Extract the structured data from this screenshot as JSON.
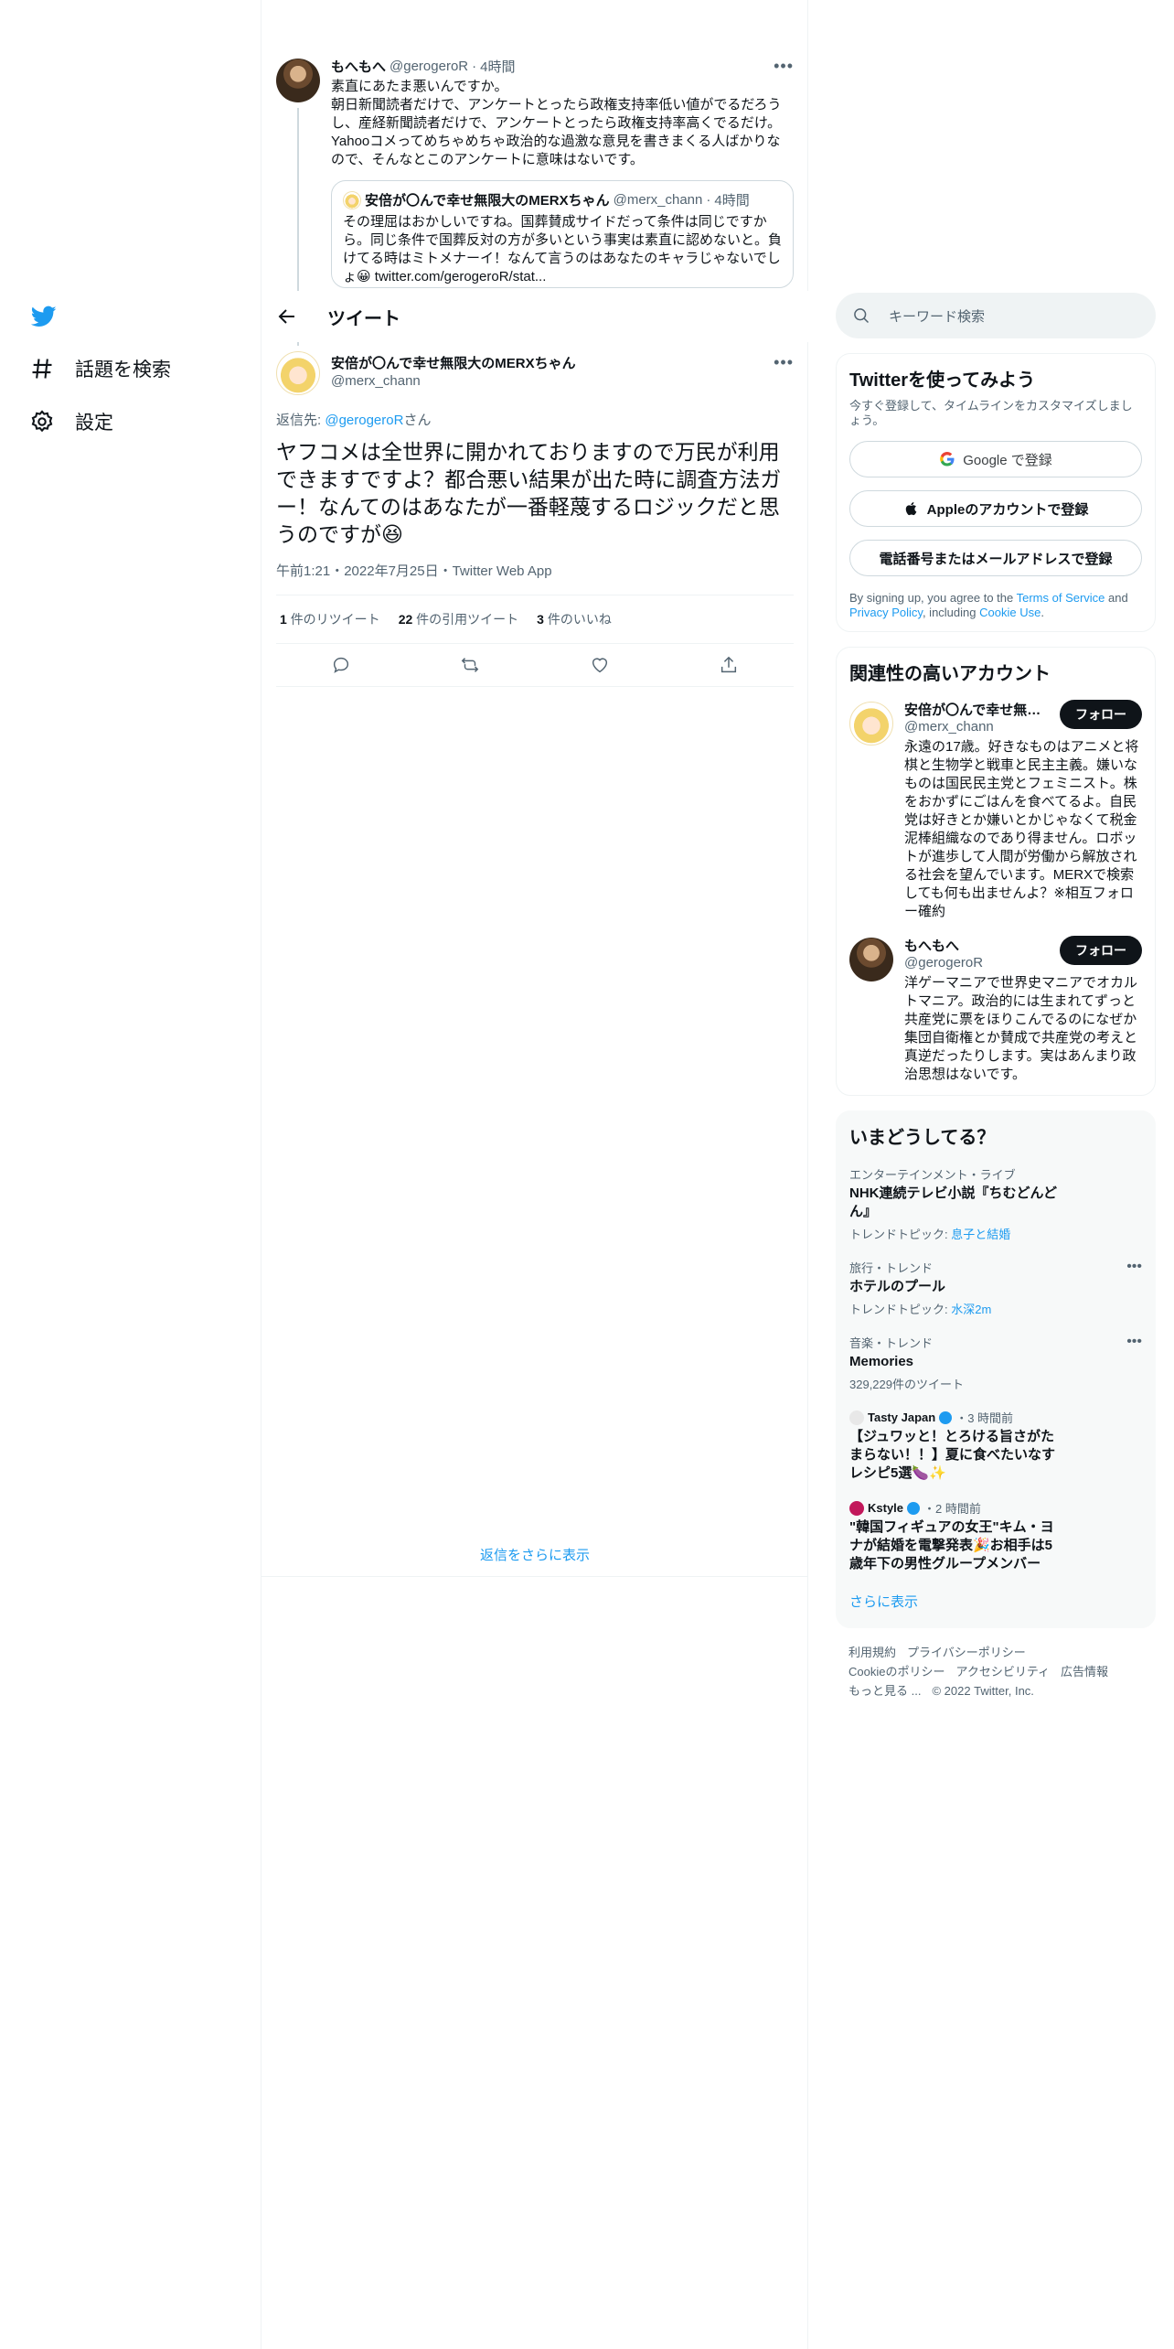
{
  "nav": {
    "explore": "話題を検索",
    "settings": "設定"
  },
  "parent_tweet": {
    "name": "もへもへ",
    "handle": "@gerogeroR",
    "time": "4時間",
    "text_lines": [
      "素直にあたま悪いんですか。",
      "朝日新聞読者だけで、アンケートとったら政権支持率低い値がでるだろうし、産経新聞読者だけで、アンケートとったら政権支持率高くでるだけ。",
      "Yahooコメってめちゃめちゃ政治的な過激な意見を書きまくる人ばかりなので、そんなとこのアンケートに意味はないです。"
    ],
    "quote": {
      "name": "安倍が〇んで幸せ無限大のMERXちゃん",
      "handle": "@merx_chann",
      "time": "4時間",
      "text": "その理屈はおかしいですね。国葬賛成サイドだって条件は同じですから。同じ条件で国葬反対の方が多いという事実は素直に認めないと。負けてる時はミトメナーイ！なんて言うのはあなたのキャラじゃないでしょ😀 twitter.com/gerogeroR/stat..."
    }
  },
  "header": {
    "title": "ツイート"
  },
  "main_tweet": {
    "name": "安倍が〇んで幸せ無限大のMERXちゃん",
    "handle": "@merx_chann",
    "reply_prefix": "返信先: ",
    "reply_to": "@gerogeroR",
    "reply_suffix": "さん",
    "text": "ヤフコメは全世界に開かれておりますので万民が利用できますですよ？都合悪い結果が出た時に調査方法ガー！なんてのはあなたが一番軽蔑するロジックだと思うのですが😆",
    "meta": "午前1:21・2022年7月25日・Twitter Web App",
    "retweets": "1",
    "retweets_label": "件のリツイート",
    "quotes": "22",
    "quotes_label": "件の引用ツイート",
    "likes": "3",
    "likes_label": "件のいいね"
  },
  "more_replies": "返信をさらに表示",
  "search": {
    "placeholder": "キーワード検索"
  },
  "signup": {
    "title": "Twitterを使ってみよう",
    "subtitle": "今すぐ登録して、タイムラインをカスタマイズしましょう。",
    "google": "Google で登録",
    "apple": "Appleのアカウントで登録",
    "phone": "電話番号またはメールアドレスで登録",
    "legal_prefix": "By signing up, you agree to the ",
    "terms": "Terms of Service",
    "and": " and ",
    "privacy": "Privacy Policy",
    "including": ", including ",
    "cookie": "Cookie Use",
    "period": "."
  },
  "related": {
    "title": "関連性の高いアカウント",
    "follow_label": "フォロー",
    "accounts": [
      {
        "name": "安倍が〇んで幸せ無限大のMERXちゃん",
        "handle": "@merx_chann",
        "bio": "永遠の17歳。好きなものはアニメと将棋と生物学と戦車と民主主義。嫌いなものは国民民主党とフェミニスト。株をおかずにごはんを食べてるよ。自民党は好きとか嫌いとかじゃなくて税金泥棒組織なのであり得ません。ロボットが進歩して人間が労働から解放される社会を望んでいます。MERXで検索しても何も出ませんよ？※相互フォロー確約"
      },
      {
        "name": "もへもへ",
        "handle": "@gerogeroR",
        "bio": "洋ゲーマニアで世界史マニアでオカルトマニア。政治的には生まれてずっと共産党に票をほりこんでるのになぜか集団自衛権とか賛成で共産党の考えと真逆だったりします。実はあんまり政治思想はないです。"
      }
    ]
  },
  "trends": {
    "title": "いまどうしてる？",
    "items": [
      {
        "category": "エンターテインメント・ライブ",
        "name": "NHK連続テレビ小説『ちむどんどん』",
        "sub_prefix": "トレンドトピック: ",
        "sub_link": "息子と結婚"
      },
      {
        "category": "旅行・トレンド",
        "name": "ホテルのプール",
        "sub_prefix": "トレンドトピック: ",
        "sub_link": "水深2m"
      },
      {
        "category": "音楽・トレンド",
        "name": "Memories",
        "sub_prefix": "329,229件のツイート",
        "sub_link": ""
      }
    ],
    "news": [
      {
        "source": "Tasty Japan",
        "time": "・3 時間前",
        "title": "【ジュワッと！とろける旨さがたまらない！！】夏に食べたいなすレシピ5選🍆✨"
      },
      {
        "source": "Kstyle",
        "time": "・2 時間前",
        "title": "\"韓国フィギュアの女王\"キム・ヨナが結婚を電撃発表🎉お相手は5歳年下の男性グループメンバー"
      }
    ],
    "show_more": "さらに表示"
  },
  "footer": {
    "line1": [
      "利用規約",
      "プライバシーポリシー"
    ],
    "line2": [
      "Cookieのポリシー",
      "アクセシビリティ",
      "広告情報"
    ],
    "line3": [
      "もっと見る ...",
      "© 2022 Twitter, Inc."
    ]
  },
  "colors": {
    "accent": "#1d9bf0",
    "text": "#0f1419",
    "muted": "#536471",
    "border": "#eff3f4"
  }
}
